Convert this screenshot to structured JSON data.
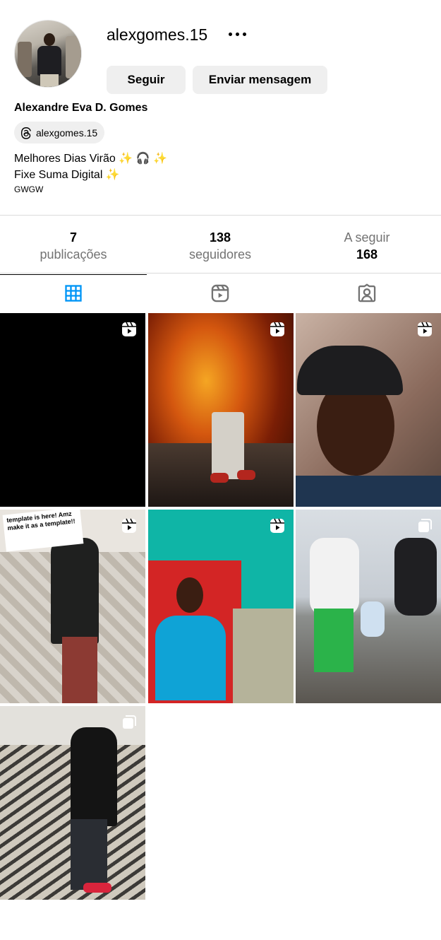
{
  "profile": {
    "username": "alexgomes.15",
    "full_name": "Alexandre Eva D. Gomes",
    "threads_handle": "alexgomes.15",
    "bio_line1_text": "Melhores Dias Virão ",
    "bio_line1_emoji": "✨ 🎧 ✨",
    "bio_line2_text": "Fixe Suma Digital ",
    "bio_line2_emoji": "✨",
    "bio_line3": "GWGW"
  },
  "actions": {
    "follow_label": "Seguir",
    "message_label": "Enviar mensagem"
  },
  "stats": {
    "posts_count": "7",
    "posts_label": "publicações",
    "followers_count": "138",
    "followers_label": "seguidores",
    "following_label": "A seguir",
    "following_count": "168"
  },
  "tabs": [
    {
      "name": "grid-icon",
      "active": true
    },
    {
      "name": "reels-icon",
      "active": false
    },
    {
      "name": "tagged-icon",
      "active": false
    }
  ],
  "posts": [
    {
      "type": "reel-icon"
    },
    {
      "type": "reel-icon"
    },
    {
      "type": "reel-icon"
    },
    {
      "type": "reel-icon",
      "overlay_text": "template is here! Amz make it as a template!!"
    },
    {
      "type": "reel-icon"
    },
    {
      "type": "carousel-icon"
    },
    {
      "type": "carousel-icon"
    }
  ],
  "colors": {
    "accent": "#0095f6",
    "button_bg": "#efefef",
    "muted_text": "#737373",
    "divider": "#dbdbdb"
  }
}
